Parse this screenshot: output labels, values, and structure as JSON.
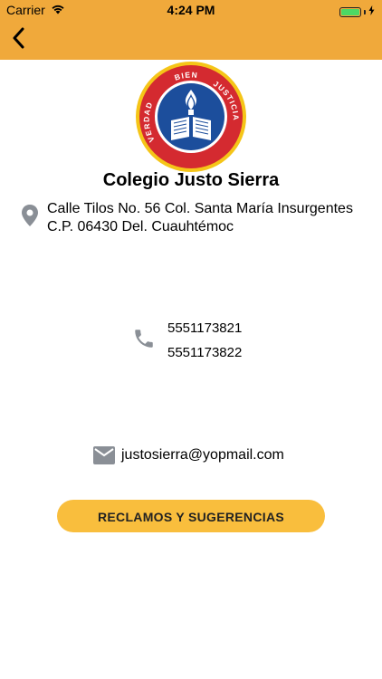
{
  "status_bar": {
    "carrier": "Carrier",
    "time": "4:24 PM"
  },
  "nav": {
    "back_icon": "chevron-left-icon"
  },
  "school": {
    "name": "Colegio Justo Sierra",
    "logo_text_left": "VERDAD",
    "logo_text_top": "BIEN",
    "logo_text_right": "JUSTICIA"
  },
  "contact": {
    "address_lines": [
      "Calle Tilos No. 56 Col. Santa María Insurgentes",
      "C.P. 06430 Del. Cuauhtémoc"
    ],
    "phones": [
      "5551173821",
      "5551173822"
    ],
    "email": "justosierra@yopmail.com"
  },
  "actions": {
    "claims_label": "RECLAMOS Y SUGERENCIAS"
  },
  "colors": {
    "header": "#F0A93B",
    "button": "#F9BE3D",
    "logo_red": "#D42A30",
    "logo_blue": "#1C4E9C",
    "logo_gold": "#F5C518",
    "icon_gray": "#8A8F96"
  }
}
